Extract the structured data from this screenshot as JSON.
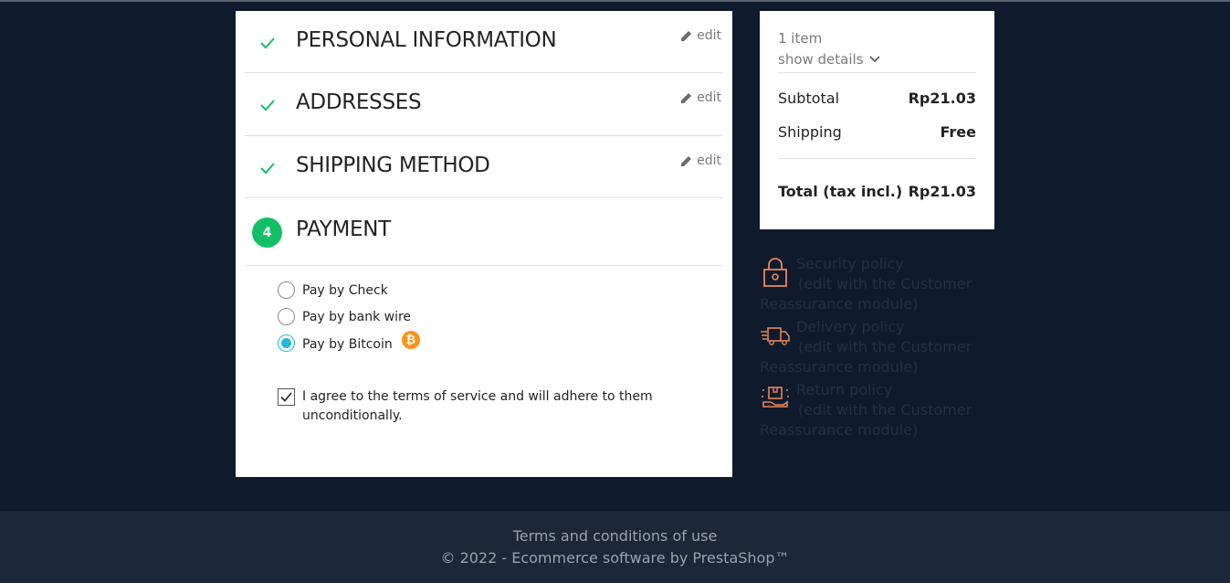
{
  "checkout": {
    "steps": [
      {
        "title": "PERSONAL INFORMATION",
        "edit": "edit",
        "status": "complete"
      },
      {
        "title": "ADDRESSES",
        "edit": "edit",
        "status": "complete"
      },
      {
        "title": "SHIPPING METHOD",
        "edit": "edit",
        "status": "complete"
      },
      {
        "number": "4",
        "title": "PAYMENT",
        "status": "current"
      }
    ],
    "payment_options": [
      {
        "label": "Pay by Check",
        "selected": false
      },
      {
        "label": "Pay by bank wire",
        "selected": false
      },
      {
        "label": "Pay by Bitcoin",
        "selected": true,
        "icon": "bitcoin-icon"
      }
    ],
    "terms": {
      "line1": "I agree to the terms of service and will adhere to them",
      "line2": "unconditionally.",
      "checked": true
    }
  },
  "summary": {
    "items_count": "1 item",
    "show_details": "show details",
    "subtotal_label": "Subtotal",
    "subtotal_value": "Rp21.03",
    "shipping_label": "Shipping",
    "shipping_value": "Free",
    "total_label": "Total (tax incl.)",
    "total_value": "Rp21.03"
  },
  "reassurance": [
    {
      "icon": "lock-icon",
      "title": "Security policy",
      "line2": "(edit with the Customer",
      "line3": "Reassurance module)"
    },
    {
      "icon": "delivery-truck-icon",
      "title": "Delivery policy",
      "line2": "(edit with the Customer",
      "line3": "Reassurance module)"
    },
    {
      "icon": "return-package-icon",
      "title": "Return policy",
      "line2": "(edit with the Customer",
      "line3": "Reassurance module)"
    }
  ],
  "footer": {
    "terms_link": "Terms and conditions of use",
    "copyright": "© 2022 - Ecommerce software by PrestaShop™"
  },
  "colors": {
    "background": "#0f1a2d",
    "accent_green": "#13bf66",
    "radio_selected": "#24b9d7",
    "bitcoin": "#f7931a",
    "reassurance_icon": "#e8865a"
  }
}
